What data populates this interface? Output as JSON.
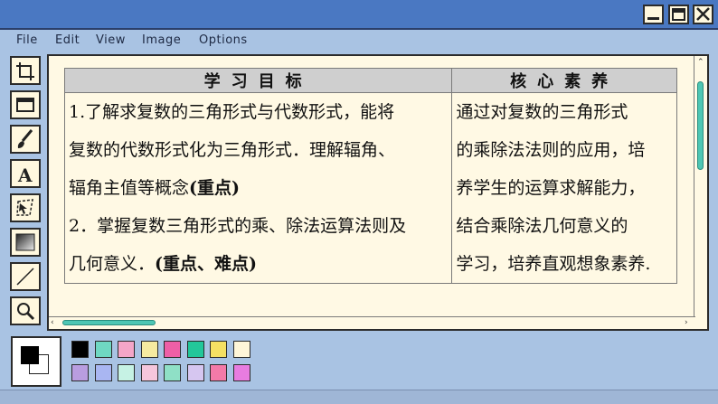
{
  "window": {
    "buttons": [
      "minimize",
      "maximize",
      "close"
    ]
  },
  "menu": {
    "items": [
      "File",
      "Edit",
      "View",
      "Image",
      "Options"
    ]
  },
  "toolbar": {
    "tools": [
      "crop-icon",
      "rectangle-select-icon",
      "brush-icon",
      "text-icon",
      "free-select-icon",
      "gradient-icon",
      "line-icon",
      "zoom-icon"
    ]
  },
  "canvas": {
    "headers": [
      "学习目标",
      "核心素养"
    ],
    "goals": {
      "line1": "1.了解求复数的三角形式与代数形式，能将",
      "line2": "复数的代数形式化为三角形式．理解辐角、",
      "line3_text": "辐角主值等概念",
      "line3_bold": "(重点)",
      "line4": "2．掌握复数三角形式的乘、除法运算法则及",
      "line5_text": "几何意义．",
      "line5_bold": "(重点、难点)"
    },
    "literacy": {
      "line1": "通过对复数的三角形式",
      "line2": "的乘除法法则的应用，培",
      "line3": "养学生的运算求解能力，",
      "line4": "结合乘除法几何意义的",
      "line5": "学习，培养直观想象素养."
    }
  },
  "palette": {
    "foreground": "#000000",
    "background": "#ffffff",
    "row1": [
      "#000000",
      "#6fd8c2",
      "#f4a6c8",
      "#f6eaa0",
      "#ee5fa6",
      "#22c79a",
      "#f5e063",
      "#fff6d8"
    ],
    "row2": [
      "#b99de0",
      "#a9b6f2",
      "#c6f2e4",
      "#f6c6dc",
      "#8fe0c6",
      "#d6c6f0",
      "#f47aa8",
      "#e87ce0"
    ]
  }
}
